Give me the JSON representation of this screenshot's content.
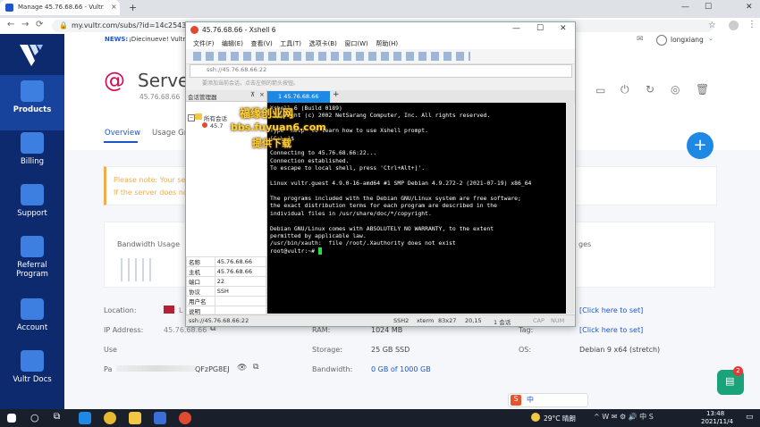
{
  "browser": {
    "tab_title": "Manage 45.76.68.66 - Vultr.co",
    "tab_close": "×",
    "new_tab": "+",
    "url": "my.vultr.com/subs/?id=14c25438-",
    "user": "longxiang"
  },
  "news": {
    "label": "NEWS:",
    "text": "¡Diecinueve! Vultr's"
  },
  "sidebar": {
    "items": [
      {
        "label": "Products"
      },
      {
        "label": "Billing"
      },
      {
        "label": "Support"
      },
      {
        "label": "Referral Program"
      },
      {
        "label": "Account"
      },
      {
        "label": "Vultr Docs"
      }
    ]
  },
  "server": {
    "title": "Server",
    "ip": "45.76.68.66",
    "tabs": [
      "Overview",
      "Usage Gra"
    ],
    "notice_line1": "Please note: Your serv",
    "notice_line2": "If the server does not",
    "bandwidth_label": "Bandwidth Usage",
    "charts_label": "ges"
  },
  "details": {
    "location_label": "Location:",
    "location_value": "L",
    "ip_label": "IP Address:",
    "ip_value": "45.76.68.66",
    "user_label": "Use",
    "pass_label": "Pa",
    "pass_value": "QFzPG8EJ",
    "ram_label": "RAM:",
    "ram_value": "1024 MB",
    "storage_label": "Storage:",
    "storage_value": "25 GB SSD",
    "bandwidth_label": "Bandwidth:",
    "bandwidth_value": "0 GB of 1000 GB",
    "tag_label": "Tag:",
    "tag_value": "[Click here to set]",
    "label_value": "[Click here to set]",
    "os_label": "OS:",
    "os_value": "Debian 9 x64 (stretch)"
  },
  "xshell": {
    "title": "45.76.68.66 - Xshell 6",
    "menu": [
      "文件(F)",
      "编辑(E)",
      "查看(V)",
      "工具(T)",
      "选项卡(B)",
      "窗口(W)",
      "帮助(H)"
    ],
    "address": "ssh://45.76.68.66:22",
    "hint": "要添加当前会话，点击左侧的箭头按钮。",
    "session_manager": "会话管理器",
    "tree_root": "所有会话",
    "tree_child": "45.7",
    "tab_label": "1 45.76.68.66",
    "tab_add": "+",
    "terminal_lines": [
      "Xshell 6 (Build 0189)",
      "Copyright (c) 2002 NetSarang Computer, Inc. All rights reserved.",
      "",
      "Type `help' to learn how to use Xshell prompt.",
      "[C:\\~]$",
      "",
      "Connecting to 45.76.68.66:22...",
      "Connection established.",
      "To escape to local shell, press 'Ctrl+Alt+]'.",
      "",
      "Linux vultr.guest 4.9.0-16-amd64 #1 SMP Debian 4.9.272-2 (2021-07-19) x86_64",
      "",
      "The programs included with the Debian GNU/Linux system are free software;",
      "the exact distribution terms for each program are described in the",
      "individual files in /usr/share/doc/*/copyright.",
      "",
      "Debian GNU/Linux comes with ABSOLUTELY NO WARRANTY, to the extent",
      "permitted by applicable law.",
      "/usr/bin/xauth:  file /root/.Xauthority does not exist",
      "root@vultr:~# "
    ],
    "props": [
      {
        "k": "名称",
        "v": "45.76.68.66"
      },
      {
        "k": "主机",
        "v": "45.76.68.66"
      },
      {
        "k": "端口",
        "v": "22"
      },
      {
        "k": "协议",
        "v": "SSH"
      },
      {
        "k": "用户名",
        "v": ""
      },
      {
        "k": "说明",
        "v": ""
      },
      {
        "k": "说明",
        "v": ""
      }
    ],
    "status_left": "ssh://45.76.68.66:22",
    "status_right": [
      "SSH2",
      "xterm",
      "83x27",
      "20,15",
      "1 会话",
      "CAP",
      "NUM"
    ]
  },
  "watermark": {
    "line1": "福缘创业网",
    "line2": "bbs.fuyuan6.com",
    "line3": "提供下载"
  },
  "taskbar": {
    "weather": "29°C 晴朗",
    "time": "13:48",
    "date": "2021/11/4",
    "ime": "中"
  },
  "chat_badge": "2",
  "colors": {
    "sidebar": "#0d2a6f",
    "accent": "#1e88e5",
    "notice": "#f0ad4e",
    "debian_red": "#d70a53"
  }
}
